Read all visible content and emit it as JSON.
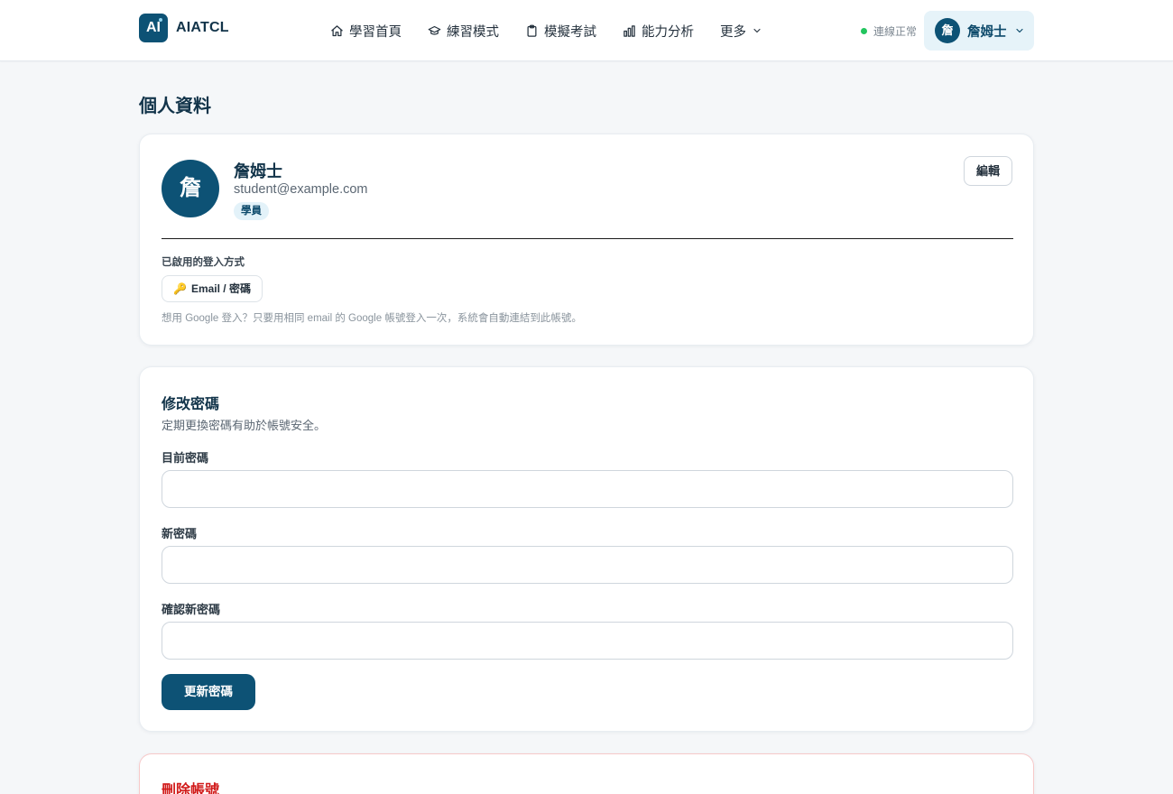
{
  "header": {
    "logo_text": "AI",
    "brand": "AIATCL",
    "nav": [
      {
        "label": "學習首頁",
        "icon": "home-icon"
      },
      {
        "label": "練習模式",
        "icon": "graduation-cap-icon"
      },
      {
        "label": "模擬考試",
        "icon": "clipboard-icon"
      },
      {
        "label": "能力分析",
        "icon": "bar-chart-icon"
      },
      {
        "label": "更多",
        "icon": "chevron-down-icon"
      }
    ],
    "status": "連線正常",
    "user": {
      "avatar": "詹",
      "name": "詹姆士"
    }
  },
  "page": {
    "title": "個人資料"
  },
  "profile": {
    "avatar": "詹",
    "name": "詹姆士",
    "email": "student@example.com",
    "role": "學員",
    "edit_label": "編輯",
    "login_methods_label": "已啟用的登入方式",
    "login_method": "Email / 密碼",
    "login_hint": "想用 Google 登入？只要用相同 email 的 Google 帳號登入一次，系統會自動連結到此帳號。"
  },
  "password": {
    "title": "修改密碼",
    "subtitle": "定期更換密碼有助於帳號安全。",
    "current_label": "目前密碼",
    "new_label": "新密碼",
    "confirm_label": "確認新密碼",
    "submit_label": "更新密碼"
  },
  "danger": {
    "title": "刪除帳號"
  },
  "colors": {
    "primary": "#0d5275",
    "danger": "#d11a1a",
    "status_ok": "#22c55e"
  }
}
